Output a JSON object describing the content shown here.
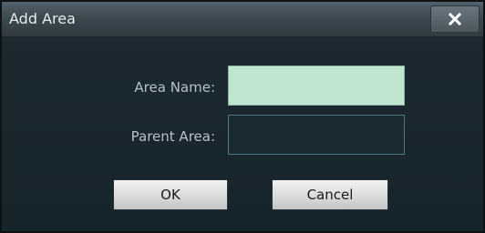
{
  "window": {
    "title": "Add Area",
    "close_icon": "close-icon"
  },
  "form": {
    "area_name_label": "Area Name:",
    "area_name_value": "",
    "parent_area_label": "Parent Area:",
    "parent_area_value": ""
  },
  "buttons": {
    "ok_label": "OK",
    "cancel_label": "Cancel"
  },
  "colors": {
    "accent_field": "#bfe5cf",
    "background": "#1b2930"
  }
}
